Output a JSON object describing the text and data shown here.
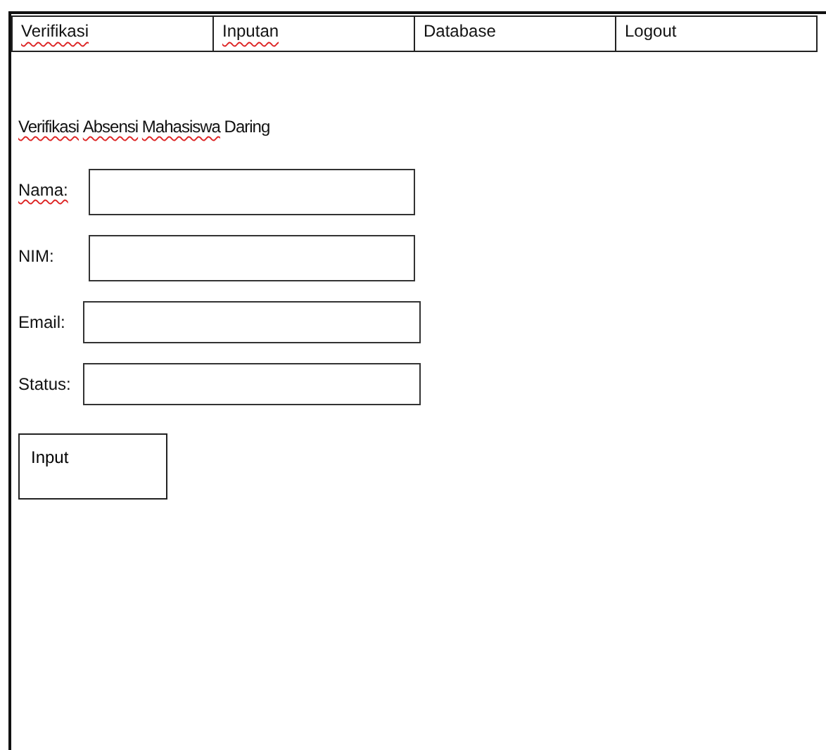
{
  "nav": [
    {
      "label": "Verifikasi",
      "spell_error": true
    },
    {
      "label": "Inputan",
      "spell_error": true
    },
    {
      "label": "Database",
      "spell_error": false
    },
    {
      "label": "Logout",
      "spell_error": false
    }
  ],
  "heading": [
    {
      "text": "Verifikasi",
      "spell_error": true
    },
    {
      "text": "Absensi",
      "spell_error": true
    },
    {
      "text": "Mahasiswa",
      "spell_error": true
    },
    {
      "text": "Daring",
      "spell_error": false
    }
  ],
  "fields": [
    {
      "label": "Nama:",
      "spell_error": true
    },
    {
      "label": "NIM:",
      "spell_error": false
    },
    {
      "label": "Email:",
      "spell_error": false
    },
    {
      "label": "Status:",
      "spell_error": false
    }
  ],
  "button": {
    "label": "Input"
  }
}
